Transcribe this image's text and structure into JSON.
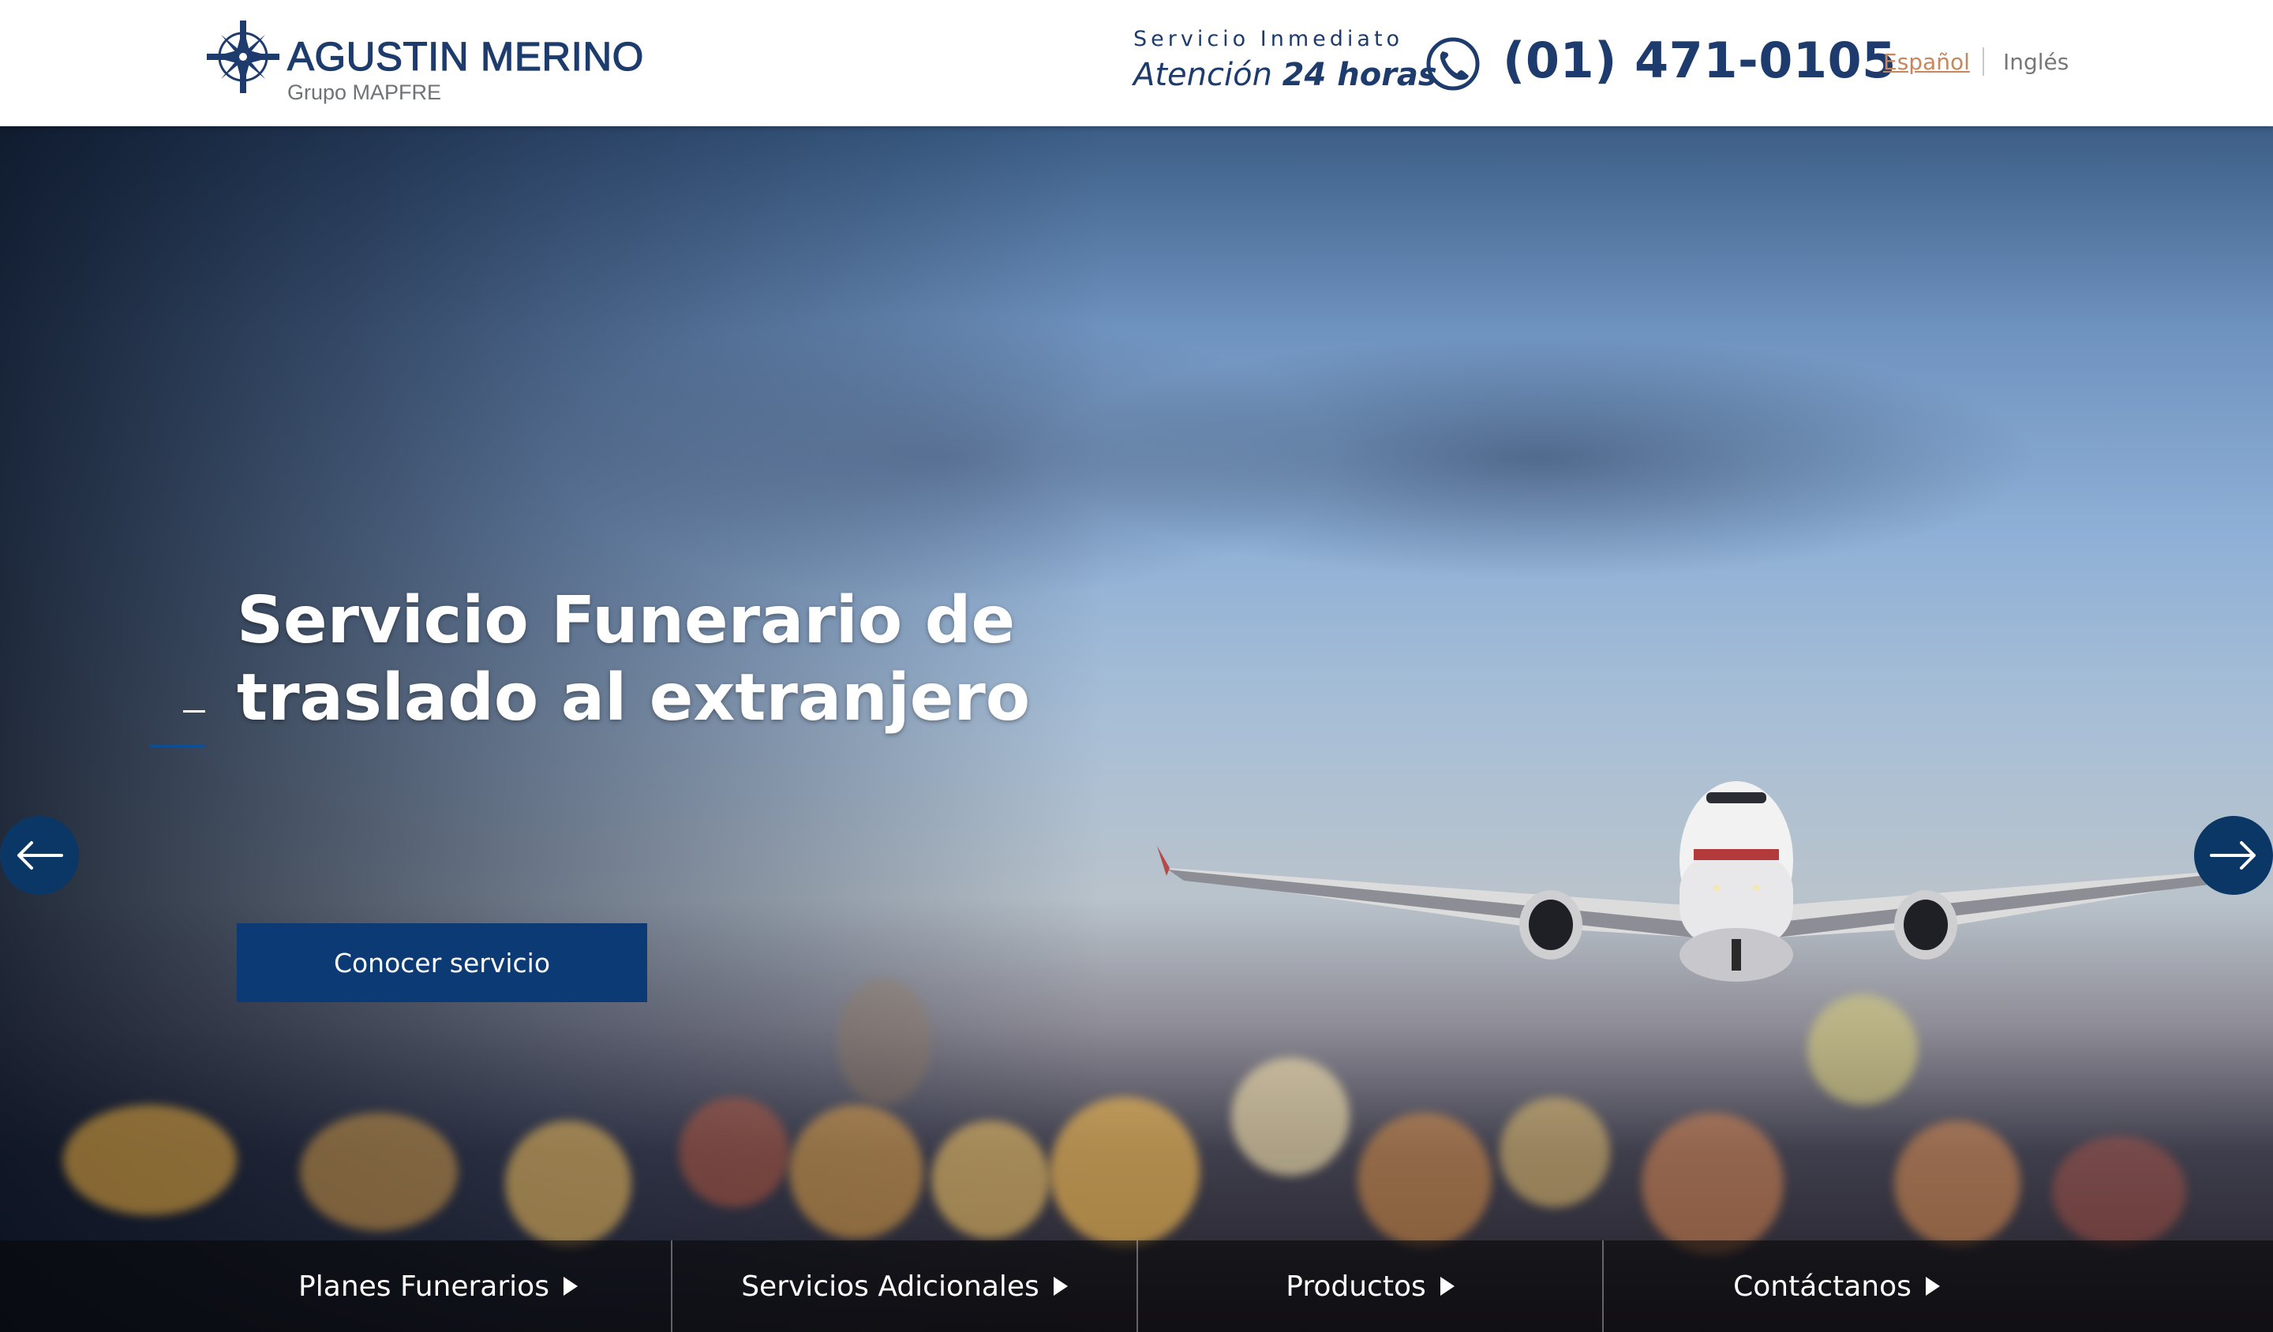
{
  "header": {
    "logo": {
      "title": "AGUSTIN MERINO",
      "subtitle": "Grupo MAPFRE",
      "icon": "compass-star-icon"
    },
    "service": {
      "top_text": "Servicio Inmediato",
      "attention_text": "Atención",
      "hours_text": "24 horas"
    },
    "phone": {
      "icon": "phone-icon",
      "number": "(01) 471-0105"
    },
    "languages": {
      "spanish": "Español",
      "english": "Inglés",
      "active": "Español"
    }
  },
  "hero": {
    "title_line1": "Servicio Funerario de",
    "title_line2": "traslado al extranjero",
    "cta_label": "Conocer servicio",
    "prev_arrow": "arrow-left-icon",
    "next_arrow": "arrow-right-icon"
  },
  "bottom_nav": {
    "items": [
      {
        "label": "Planes Funerarios",
        "icon": "triangle-right-icon"
      },
      {
        "label": "Servicios Adicionales",
        "icon": "triangle-right-icon"
      },
      {
        "label": "Productos",
        "icon": "triangle-right-icon"
      },
      {
        "label": "Contáctanos",
        "icon": "triangle-right-icon"
      }
    ]
  },
  "colors": {
    "brand_navy": "#1d3c6d",
    "cta_blue": "#0b3a75",
    "active_language": "#c8865a"
  }
}
